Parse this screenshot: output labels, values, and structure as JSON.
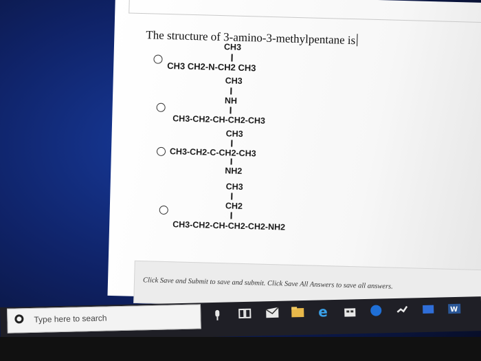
{
  "question": {
    "text": "The structure of 3-amino-3-methylpentane is"
  },
  "options": [
    {
      "top": "CH3",
      "main": "CH3 CH2-N-CH2 CH3"
    },
    {
      "top1": "CH3",
      "top2": "NH",
      "main": "CH3-CH2-CH-CH2-CH3"
    },
    {
      "top": "CH3",
      "main": "CH3-CH2-C-CH2-CH3",
      "bottom": "NH2"
    },
    {
      "top1": "CH3",
      "top2": "CH2",
      "main": "CH3-CH2-CH-CH2-CH2-NH2"
    }
  ],
  "footer": {
    "text": "Click Save and Submit to save and submit. Click Save All Answers to save all answers."
  },
  "taskbar": {
    "search_placeholder": "Type here to search"
  },
  "icons": [
    "cortana-icon",
    "mic-icon",
    "task-view-icon",
    "mail-icon",
    "file-explorer-icon",
    "edge-icon",
    "store-icon",
    "edge-blue-icon",
    "photos-icon",
    "app-icon",
    "word-icon"
  ]
}
